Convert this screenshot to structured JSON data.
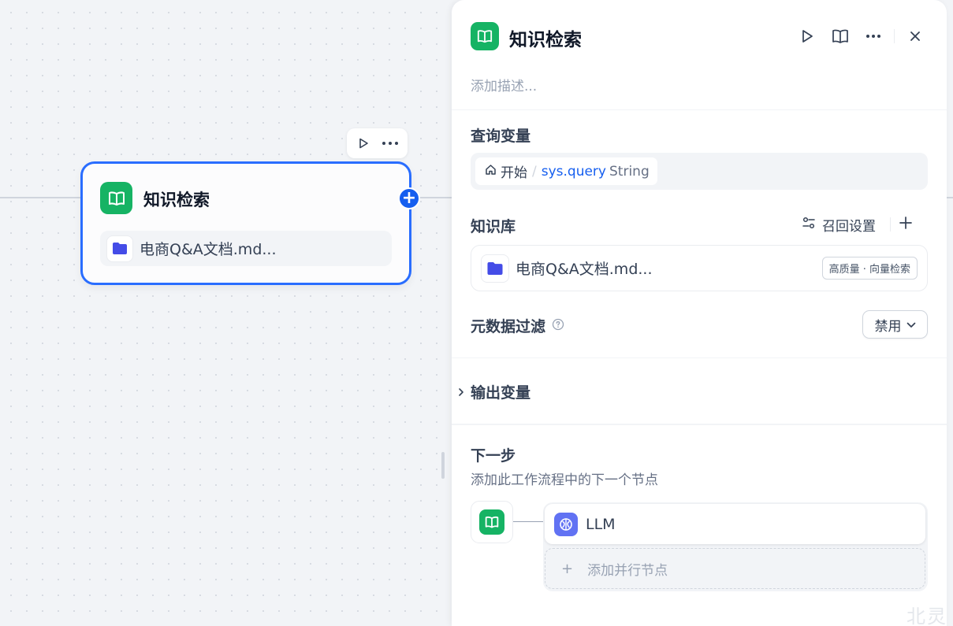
{
  "canvas": {
    "node": {
      "title": "知识检索",
      "icon": "book-open-icon",
      "knowledge_name": "电商Q&A文档.md..."
    },
    "toolbar": {
      "run_icon": "play-icon",
      "more_icon": "more-horizontal-icon"
    }
  },
  "panel": {
    "title": "知识检索",
    "description_placeholder": "添加描述...",
    "query": {
      "title": "查询变量",
      "source_node": "开始",
      "separator": "/",
      "variable": "sys.query",
      "type": "String"
    },
    "knowledge": {
      "title": "知识库",
      "recall_settings": "召回设置",
      "item_name": "电商Q&A文档.md...",
      "item_badge": "高质量 · 向量检索"
    },
    "metadata": {
      "title": "元数据过滤",
      "value": "禁用"
    },
    "output": {
      "title": "输出变量"
    },
    "next": {
      "title": "下一步",
      "description": "添加此工作流程中的下一个节点",
      "node_name": "LLM",
      "add_parallel": "添加并行节点"
    }
  },
  "watermark": "北灵",
  "colors": {
    "accent": "#155eef",
    "node_border": "#296dff",
    "knowledge_green": "#16b364",
    "llm_indigo": "#6172f3",
    "folder_blue": "#444ce7"
  }
}
